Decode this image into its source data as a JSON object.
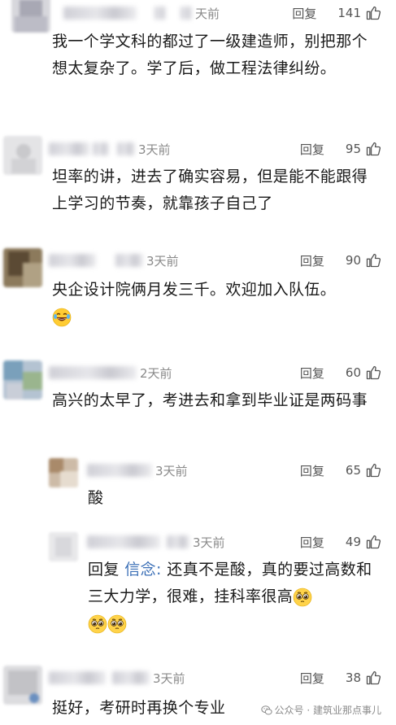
{
  "reply_label": "回复",
  "comments": [
    {
      "time": "天前",
      "likes": "141",
      "text": "我一个学文科的都过了一级建造师，别把那个想太复杂了。学了后，做工程法律纠纷。"
    },
    {
      "time": "3天前",
      "likes": "95",
      "text": "坦率的讲，进去了确实容易，但是能不能跟得上学习的节奏，就靠孩子自己了"
    },
    {
      "time": "3天前",
      "likes": "90",
      "text": "央企设计院俩月发三千。欢迎加入队伍。"
    },
    {
      "time": "2天前",
      "likes": "60",
      "text": "高兴的太早了，考进去和拿到毕业证是两码事"
    },
    {
      "time": "3天前",
      "likes": "65",
      "text": "酸"
    },
    {
      "time": "3天前",
      "likes": "49",
      "text_prefix": "回复 ",
      "mention": "信念:",
      "text": " 还真不是酸，真的要过高数和三大力学，很难，挂科率很高"
    },
    {
      "time": "3天前",
      "likes": "38",
      "text": "挺好，考研时再换个专业"
    }
  ],
  "watermark": {
    "text": "公众号 · 建筑业那点事儿"
  },
  "icons": {
    "like": "thumbs-up-icon",
    "laugh": "face-with-tears-of-joy-icon",
    "pleading": "pleading-face-icon",
    "watermark": "wechat-icon"
  },
  "colors": {
    "text": "#1a1a1a",
    "muted": "#8a8a8a",
    "mention": "#3b6fb6"
  }
}
